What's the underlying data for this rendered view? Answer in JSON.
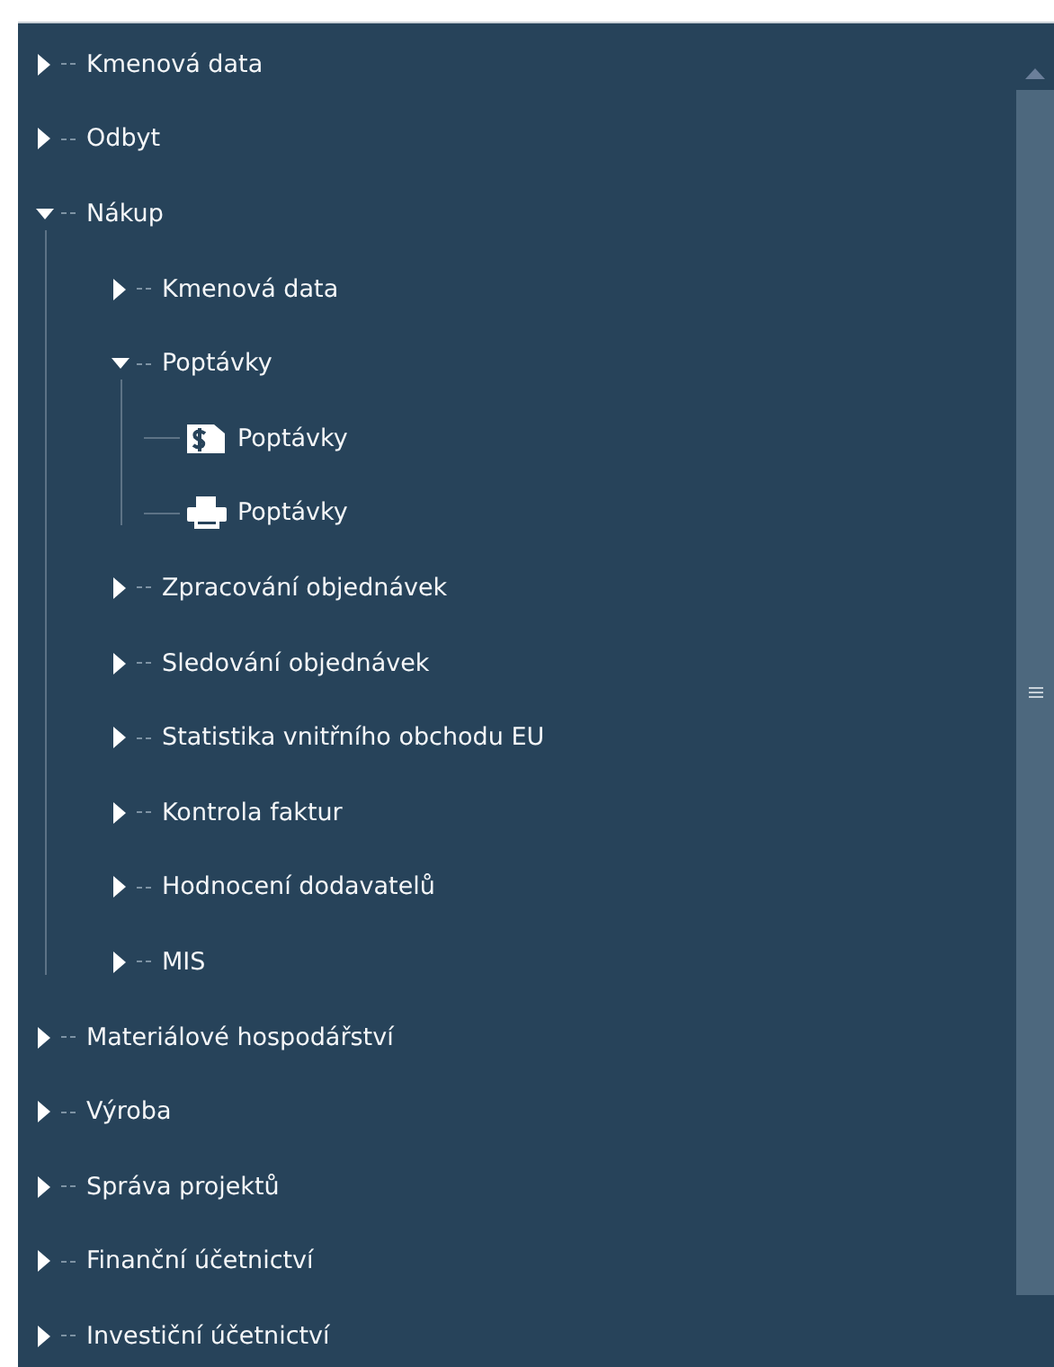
{
  "tree": [
    {
      "label": "Kmenová data",
      "kind": "folder",
      "expanded": false
    },
    {
      "label": "Odbyt",
      "kind": "folder",
      "expanded": false
    },
    {
      "label": "Nákup",
      "kind": "folder",
      "expanded": true,
      "children": [
        {
          "label": "Kmenová data",
          "kind": "folder",
          "expanded": false
        },
        {
          "label": "Poptávky",
          "kind": "folder",
          "expanded": true,
          "children": [
            {
              "label": "Poptávky",
              "kind": "dollar-document"
            },
            {
              "label": "Poptávky",
              "kind": "printer"
            }
          ]
        },
        {
          "label": "Zpracování objednávek",
          "kind": "folder",
          "expanded": false
        },
        {
          "label": "Sledování objednávek",
          "kind": "folder",
          "expanded": false
        },
        {
          "label": "Statistika vnitřního obchodu EU",
          "kind": "folder",
          "expanded": false
        },
        {
          "label": "Kontrola faktur",
          "kind": "folder",
          "expanded": false
        },
        {
          "label": "Hodnocení dodavatelů",
          "kind": "folder",
          "expanded": false
        },
        {
          "label": "MIS",
          "kind": "folder",
          "expanded": false
        }
      ]
    },
    {
      "label": "Materiálové hospodářství",
      "kind": "folder",
      "expanded": false
    },
    {
      "label": "Výroba",
      "kind": "folder",
      "expanded": false
    },
    {
      "label": "Správa projektů",
      "kind": "folder",
      "expanded": false
    },
    {
      "label": "Finanční účetnictví",
      "kind": "folder",
      "expanded": false
    },
    {
      "label": "Investiční účetnictví",
      "kind": "folder",
      "expanded": false
    }
  ]
}
